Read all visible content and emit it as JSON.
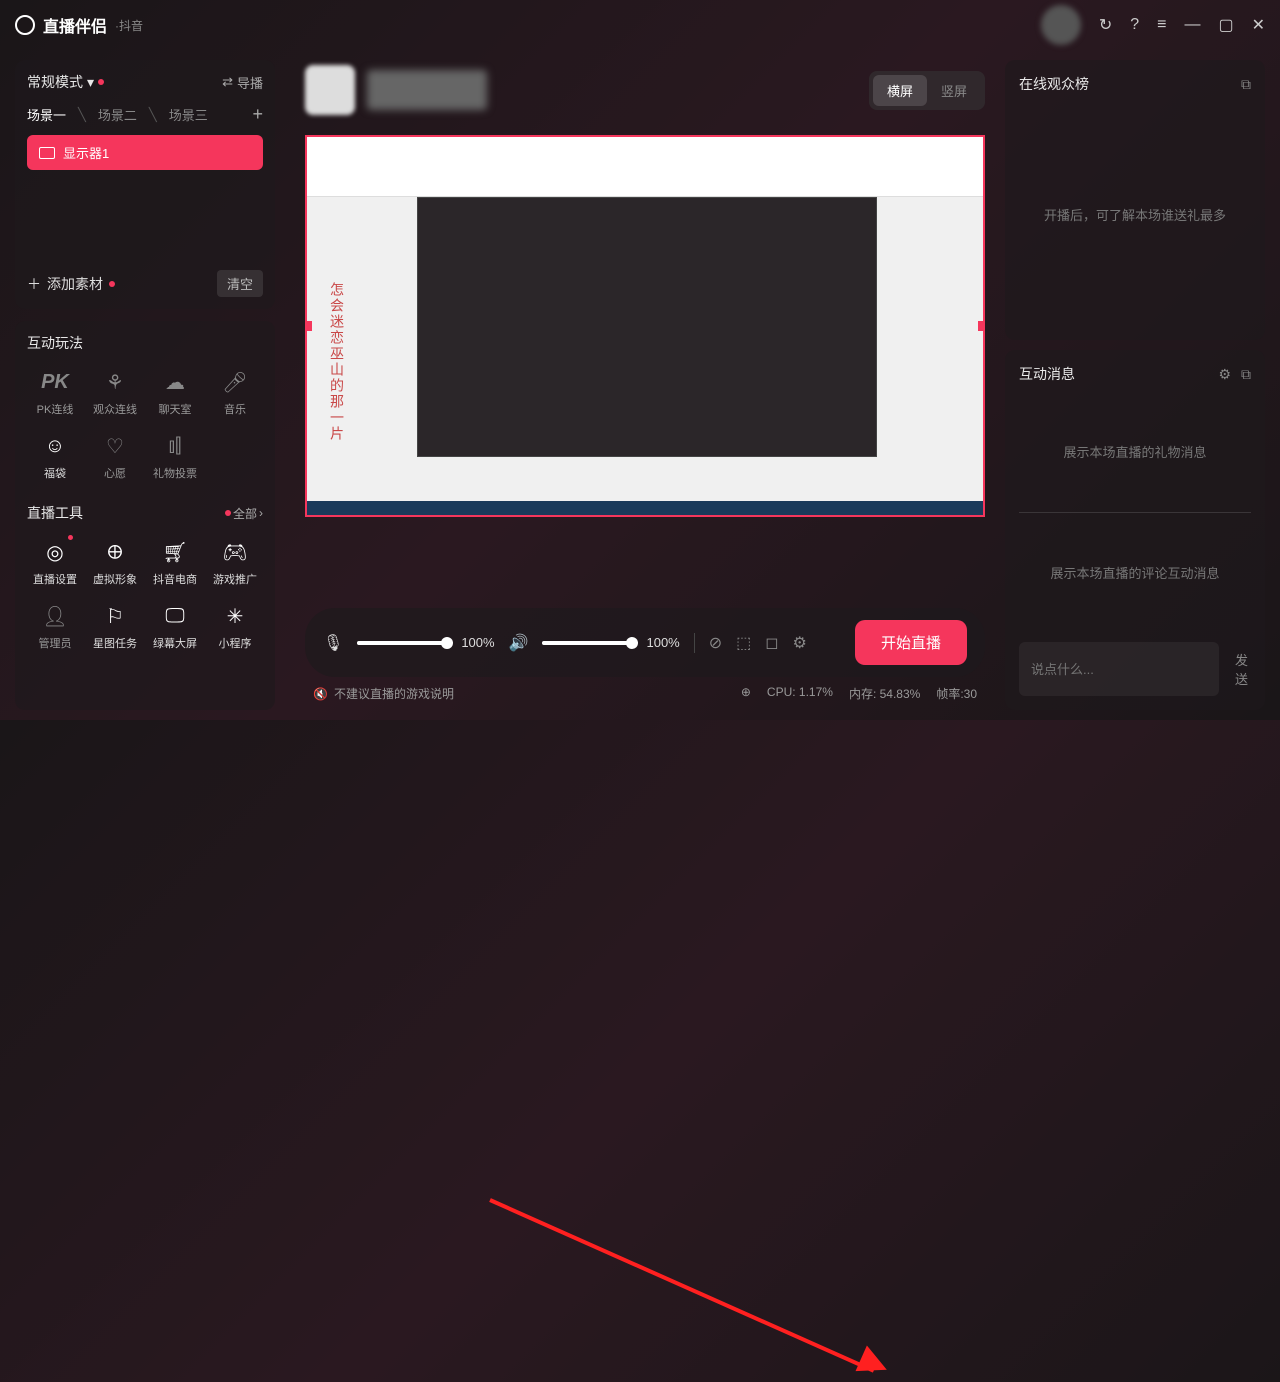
{
  "titlebar": {
    "app_name": "直播伴侣",
    "app_sub": "·抖音"
  },
  "sidebar": {
    "mode": "常规模式",
    "guide": "导播",
    "scenes": [
      "场景一",
      "场景二",
      "场景三"
    ],
    "active_scene": 0,
    "sources": [
      {
        "name": "显示器1"
      }
    ],
    "add_source": "添加素材",
    "clear": "清空"
  },
  "interactive": {
    "title": "互动玩法",
    "items": [
      {
        "label": "PK连线",
        "icon": "PK"
      },
      {
        "label": "观众连线",
        "icon": "link"
      },
      {
        "label": "聊天室",
        "icon": "chat"
      },
      {
        "label": "音乐",
        "icon": "mic"
      },
      {
        "label": "福袋",
        "icon": "bag",
        "hl": true
      },
      {
        "label": "心愿",
        "icon": "heart"
      },
      {
        "label": "礼物投票",
        "icon": "vote"
      }
    ]
  },
  "tools": {
    "title": "直播工具",
    "all": "全部",
    "items": [
      {
        "label": "直播设置",
        "icon": "gear",
        "reddot": true
      },
      {
        "label": "虚拟形象",
        "icon": "avatar"
      },
      {
        "label": "抖音电商",
        "icon": "cart"
      },
      {
        "label": "游戏推广",
        "icon": "gamepad"
      },
      {
        "label": "管理员",
        "icon": "admin"
      },
      {
        "label": "星图任务",
        "icon": "star"
      },
      {
        "label": "绿幕大屏",
        "icon": "screen"
      },
      {
        "label": "小程序",
        "icon": "spark"
      }
    ]
  },
  "center": {
    "orient_h": "横屏",
    "orient_v": "竖屏",
    "mic_vol": "100%",
    "spk_vol": "100%",
    "start": "开始直播",
    "game_note": "不建议直播的游戏说明",
    "cpu": "CPU: 1.17%",
    "mem": "内存: 54.83%",
    "fps": "帧率:30",
    "mock_text": "怎会迷恋巫山的那一片"
  },
  "right": {
    "viewers_title": "在线观众榜",
    "viewers_placeholder": "开播后，可了解本场谁送礼最多",
    "msgs_title": "互动消息",
    "gift_placeholder": "展示本场直播的礼物消息",
    "comment_placeholder": "展示本场直播的评论互动消息",
    "input_placeholder": "说点什么...",
    "send": "发送"
  }
}
